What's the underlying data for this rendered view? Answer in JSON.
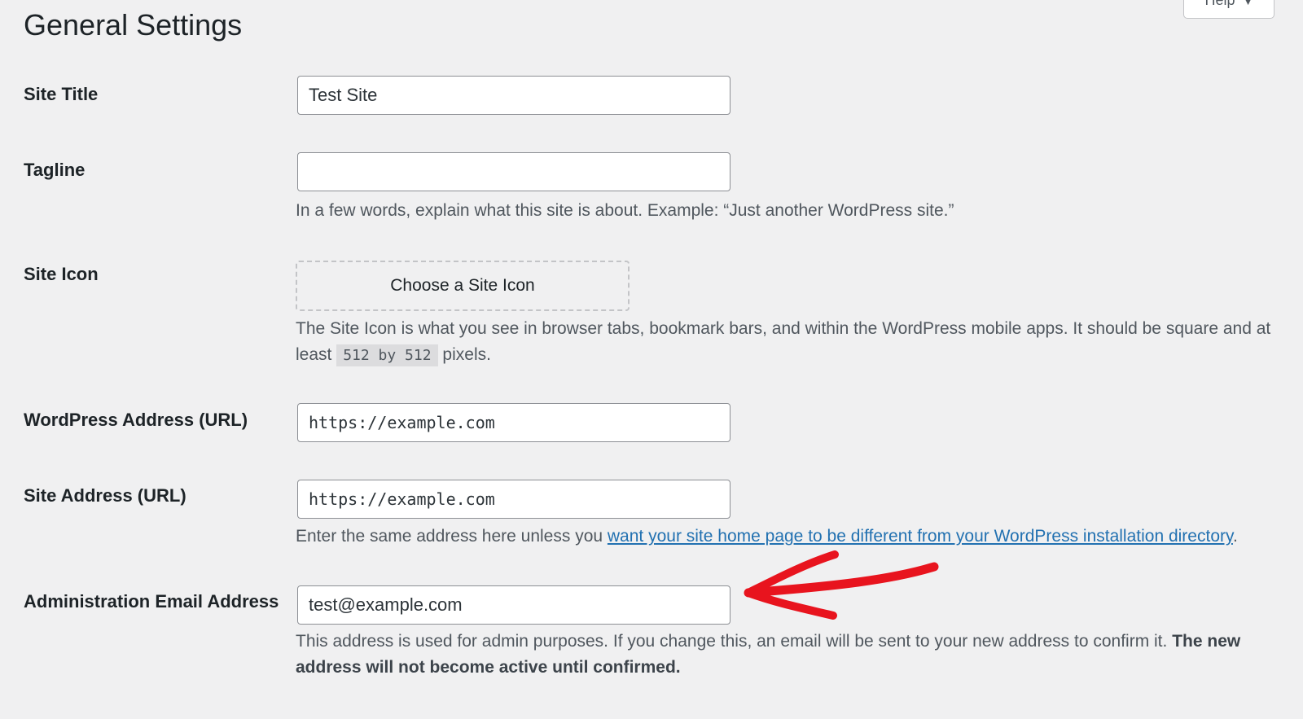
{
  "header": {
    "title": "General Settings",
    "help_label": "Help"
  },
  "fields": {
    "site_title": {
      "label": "Site Title",
      "value": "Test Site"
    },
    "tagline": {
      "label": "Tagline",
      "value": "",
      "description": "In a few words, explain what this site is about. Example: “Just another WordPress site.”"
    },
    "site_icon": {
      "label": "Site Icon",
      "button_label": "Choose a Site Icon",
      "description_part1": "The Site Icon is what you see in browser tabs, bookmark bars, and within the WordPress mobile apps. It should be square and at least",
      "description_code": "512 by 512",
      "description_part2": "pixels."
    },
    "wordpress_address": {
      "label": "WordPress Address (URL)",
      "value": "https://example.com"
    },
    "site_address": {
      "label": "Site Address (URL)",
      "value": "https://example.com",
      "description_before_link": "Enter the same address here unless you",
      "link_text": "want your site home page to be different from your WordPress installation directory",
      "description_after_link": "."
    },
    "admin_email": {
      "label": "Administration Email Address",
      "value": "test@example.com",
      "description": "This address is used for admin purposes. If you change this, an email will be sent to your new address to confirm it.",
      "description_bold": "The new address will not become active until confirmed."
    }
  },
  "annotation": {
    "arrow_color": "#e8141e"
  },
  "colors": {
    "background": "#f0f0f1",
    "link": "#2271b1",
    "description_text": "#50575e"
  }
}
